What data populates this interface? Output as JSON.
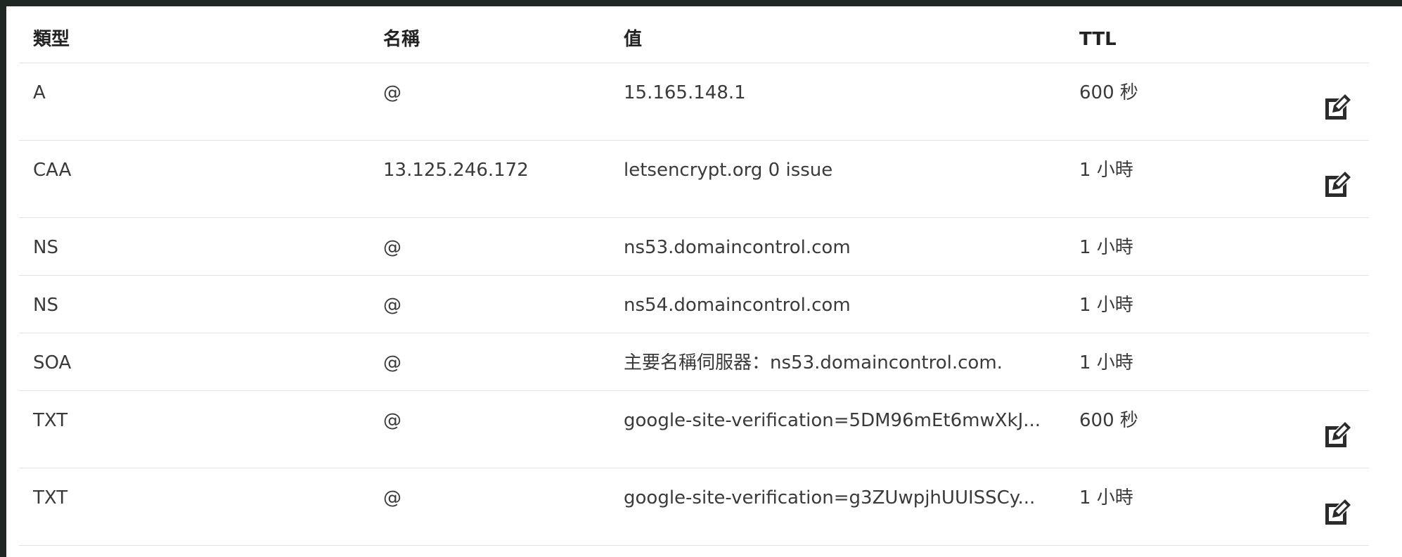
{
  "table": {
    "headers": {
      "type": "類型",
      "name": "名稱",
      "value": "值",
      "ttl": "TTL"
    },
    "rows": [
      {
        "type": "A",
        "name": "@",
        "value": "15.165.148.1",
        "ttl": "600 秒",
        "editable": true
      },
      {
        "type": "CAA",
        "name": "13.125.246.172",
        "value": "letsencrypt.org 0 issue",
        "ttl": "1 小時",
        "editable": true
      },
      {
        "type": "NS",
        "name": "@",
        "value": "ns53.domaincontrol.com",
        "ttl": "1 小時",
        "editable": false
      },
      {
        "type": "NS",
        "name": "@",
        "value": "ns54.domaincontrol.com",
        "ttl": "1 小時",
        "editable": false
      },
      {
        "type": "SOA",
        "name": "@",
        "value": "主要名稱伺服器：ns53.domaincontrol.com.",
        "ttl": "1 小時",
        "editable": false
      },
      {
        "type": "TXT",
        "name": "@",
        "value": "google-site-verification=5DM96mEt6mwXkJ...",
        "ttl": "600 秒",
        "editable": true
      },
      {
        "type": "TXT",
        "name": "@",
        "value": "google-site-verification=g3ZUwpjhUUISSCy...",
        "ttl": "1 小時",
        "editable": true
      }
    ]
  },
  "icons": {
    "edit": "edit-icon"
  }
}
